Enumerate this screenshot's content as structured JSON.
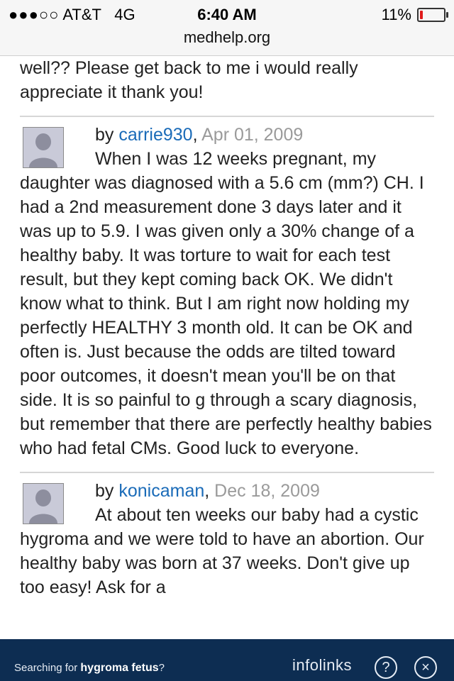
{
  "status_bar": {
    "signal": "●●●○○",
    "carrier": "AT&T",
    "network": "4G",
    "time": "6:40 AM",
    "battery_percent": "11%",
    "battery_level": 0.11,
    "url": "medhelp.org"
  },
  "lead_text": "well?? Please get back to me i would really appreciate it thank you!",
  "posts": [
    {
      "by": "by",
      "author": "carrie930",
      "date": "Apr 01, 2009",
      "body": "When I was 12 weeks pregnant, my daughter was diagnosed with a 5.6 cm (mm?) CH. I had a 2nd measurement done  3 days later and it was up to 5.9. I was given only a 30% change of a healthy baby. It was torture to wait for each test result, but they kept coming back OK. We didn't know what to think. But I am right now holding my perfectly HEALTHY 3 month old. It can be OK and often is.  Just because the odds are tilted toward poor outcomes, it doesn't mean you'll be on that side.  It is so painful to g through a scary diagnosis, but remember that there are perfectly healthy babies who had fetal CMs. Good luck to everyone."
    },
    {
      "by": "by",
      "author": "konicaman",
      "date": "Dec 18, 2009",
      "body": "At about ten weeks our baby had a cystic hygroma and we were told to have an abortion. Our healthy baby was born at 37 weeks. Don't give up too easy! Ask for a"
    }
  ],
  "footer": {
    "searching_label": "Searching for",
    "search_term": "hygroma fetus",
    "question_mark": "?",
    "brand": "infolinks",
    "help_icon": "?",
    "close_icon": "×"
  }
}
